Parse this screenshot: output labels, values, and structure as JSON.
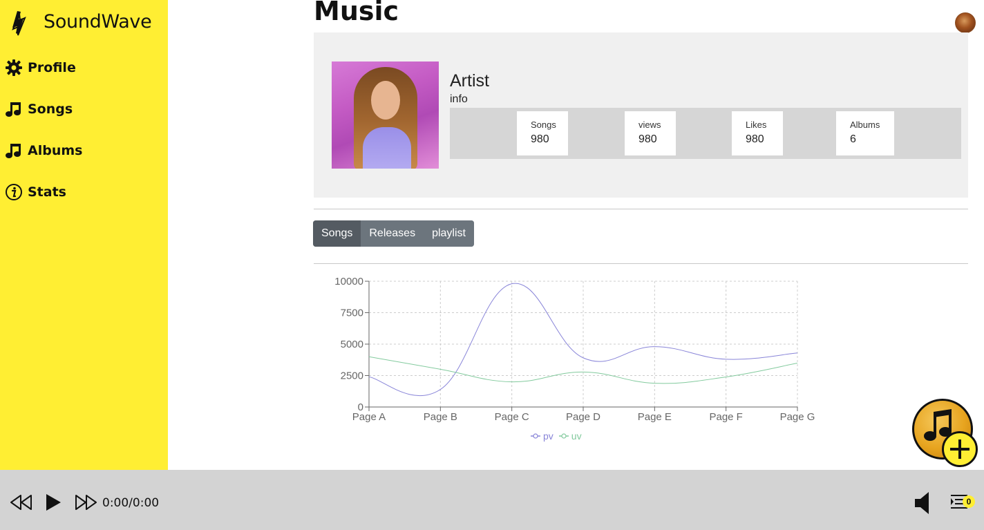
{
  "brand": {
    "name": "SoundWave",
    "logo_icon": "lightning-bolt-icon"
  },
  "sidebar": {
    "items": [
      {
        "label": "Profile",
        "icon": "gear-icon"
      },
      {
        "label": "Songs",
        "icon": "music-note-icon"
      },
      {
        "label": "Albums",
        "icon": "music-note-icon"
      },
      {
        "label": "Stats",
        "icon": "info-icon"
      }
    ]
  },
  "page": {
    "title": "Music"
  },
  "artist": {
    "name": "Artist",
    "info": "info",
    "stats": [
      {
        "label": "Songs",
        "value": "980"
      },
      {
        "label": "views",
        "value": "980"
      },
      {
        "label": "Likes",
        "value": "980"
      },
      {
        "label": "Albums",
        "value": "6"
      }
    ]
  },
  "tabs": [
    {
      "label": "Songs",
      "active": true
    },
    {
      "label": "Releases",
      "active": false
    },
    {
      "label": "playlist",
      "active": false
    }
  ],
  "chart_data": {
    "type": "line",
    "categories": [
      "Page A",
      "Page B",
      "Page C",
      "Page D",
      "Page E",
      "Page F",
      "Page G"
    ],
    "series": [
      {
        "name": "pv",
        "color": "#8884d8",
        "values": [
          2400,
          1398,
          9800,
          3908,
          4800,
          3800,
          4300
        ]
      },
      {
        "name": "uv",
        "color": "#82ca9d",
        "values": [
          4000,
          3000,
          2000,
          2780,
          1890,
          2390,
          3490
        ]
      }
    ],
    "yticks": [
      0,
      2500,
      5000,
      7500,
      10000
    ],
    "ylim": [
      0,
      10000
    ],
    "grid": true,
    "legend": "bottom"
  },
  "player": {
    "time": "0:00/0:00",
    "queue_count": "0"
  },
  "colors": {
    "sidebar": "#ffee33",
    "player": "#d3d3d3",
    "panel": "#f0f0f0",
    "tab": "#6c757d",
    "tab_active": "#545b62"
  }
}
